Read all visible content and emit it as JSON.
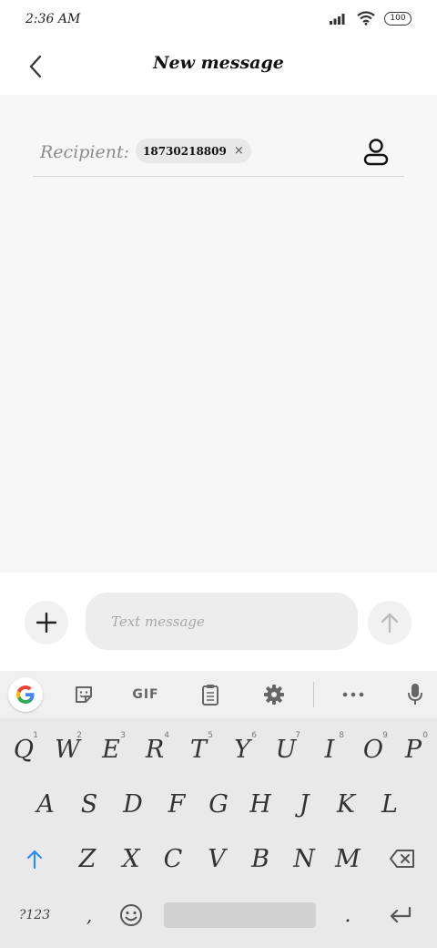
{
  "status_bar": {
    "time": "2:36 AM",
    "battery": "100",
    "icons": [
      "signal-icon",
      "wifi-icon",
      "battery-icon"
    ]
  },
  "header": {
    "title": "New message",
    "back_icon": "back-chevron-icon"
  },
  "recipient": {
    "label": "Recipient:",
    "chip": "18730218809",
    "chip_remove": "×",
    "contact_icon": "contact-person-icon"
  },
  "composer": {
    "placeholder": "Text message",
    "add_icon": "plus-icon",
    "send_icon": "arrow-up-icon"
  },
  "keyboard": {
    "toolbar": {
      "gif": "GIF",
      "icons": [
        "google-icon",
        "sticker-icon",
        "gif-icon",
        "clipboard-icon",
        "gear-icon",
        "more-icon",
        "mic-icon"
      ]
    },
    "row1": [
      {
        "key": "Q",
        "hint": "1"
      },
      {
        "key": "W",
        "hint": "2"
      },
      {
        "key": "E",
        "hint": "3"
      },
      {
        "key": "R",
        "hint": "4"
      },
      {
        "key": "T",
        "hint": "5"
      },
      {
        "key": "Y",
        "hint": "6"
      },
      {
        "key": "U",
        "hint": "7"
      },
      {
        "key": "I",
        "hint": "8"
      },
      {
        "key": "O",
        "hint": "9"
      },
      {
        "key": "P",
        "hint": "0"
      }
    ],
    "row2": [
      "A",
      "S",
      "D",
      "F",
      "G",
      "H",
      "J",
      "K",
      "L"
    ],
    "row3": [
      "Z",
      "X",
      "C",
      "V",
      "B",
      "N",
      "M"
    ],
    "row4": {
      "symbols": "?123",
      "comma": ",",
      "period": "."
    },
    "accent_color": "#2b8ff0"
  }
}
